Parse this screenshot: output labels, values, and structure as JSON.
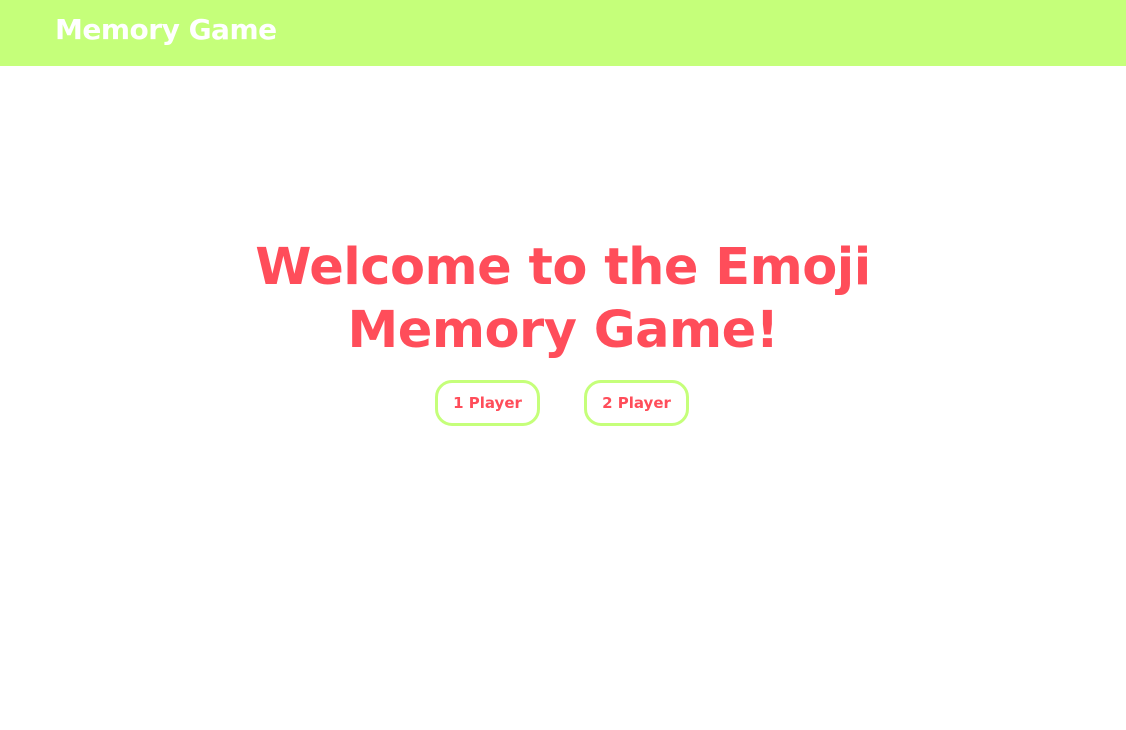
{
  "header": {
    "title": "Memory Game",
    "background_color": "#c5ff7a",
    "title_color": "#ffffff"
  },
  "hero": {
    "title": "Welcome to the Emoji Memory Game!",
    "title_color": "#ff4d5a"
  },
  "mode_buttons": [
    {
      "label": "1 Player"
    },
    {
      "label": "2 Player"
    }
  ],
  "colors": {
    "accent": "#ff4d5a",
    "brand": "#c5ff7a",
    "background": "#ffffff"
  }
}
